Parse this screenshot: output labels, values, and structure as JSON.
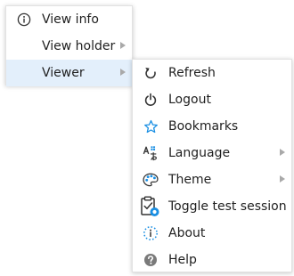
{
  "main_menu": {
    "items": [
      {
        "label": "View info",
        "icon": "info-circle-icon",
        "has_submenu": false,
        "highlighted": false
      },
      {
        "label": "View holder",
        "icon": "",
        "has_submenu": true,
        "highlighted": false
      },
      {
        "label": "Viewer",
        "icon": "",
        "has_submenu": true,
        "highlighted": true
      }
    ]
  },
  "viewer_submenu": {
    "items": [
      {
        "label": "Refresh",
        "icon": "refresh-icon",
        "has_submenu": false
      },
      {
        "label": "Logout",
        "icon": "power-icon",
        "has_submenu": false
      },
      {
        "label": "Bookmarks",
        "icon": "star-icon",
        "has_submenu": false
      },
      {
        "label": "Language",
        "icon": "translate-icon",
        "has_submenu": true
      },
      {
        "label": "Theme",
        "icon": "palette-icon",
        "has_submenu": true
      },
      {
        "label": "Toggle test session",
        "icon": "clipboard-check-icon",
        "has_submenu": false
      },
      {
        "label": "About",
        "icon": "info-dotted-circle-icon",
        "has_submenu": false
      },
      {
        "label": "Help",
        "icon": "help-circle-icon",
        "has_submenu": false
      }
    ]
  },
  "colors": {
    "highlight": "#e3effb",
    "accent_blue": "#1a8fe3",
    "arrow": "#a9a9a9",
    "text": "#1f1f1f"
  }
}
